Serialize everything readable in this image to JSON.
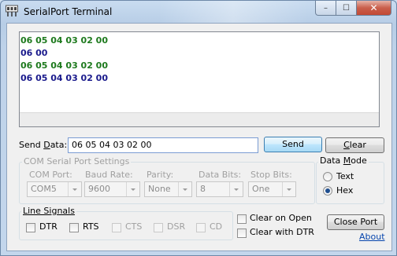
{
  "window": {
    "title": "SerialPort Terminal"
  },
  "titlebar_controls": {
    "minimize": "–",
    "maximize": "☐",
    "close": "✕"
  },
  "terminal": {
    "lines": [
      {
        "text": "06 05 04 03 02 00",
        "color": "#1e7a1e"
      },
      {
        "text": "06 00",
        "color": "#1a1a8c"
      },
      {
        "text": "06 05 04 03 02 00",
        "color": "#1e7a1e"
      },
      {
        "text": "06 05 04 03 02 00",
        "color": "#1a1a8c"
      }
    ]
  },
  "send": {
    "label_prefix": "Send ",
    "label_underlined": "D",
    "label_suffix": "ata:",
    "value": "06 05 04 03 02 00",
    "send_button": "Send",
    "clear_button_underlined": "C",
    "clear_button_suffix": "lear"
  },
  "com_settings": {
    "group_title": "COM Serial Port Settings",
    "port_label": "COM Port:",
    "port_value": "COM5",
    "baud_label": "Baud Rate:",
    "baud_value": "9600",
    "parity_label": "Parity:",
    "parity_value": "None",
    "databits_label": "Data Bits:",
    "databits_value": "8",
    "stopbits_label": "Stop Bits:",
    "stopbits_value": "One"
  },
  "data_mode": {
    "group_title_prefix": "Data ",
    "group_title_underlined": "M",
    "group_title_suffix": "ode",
    "text_label": "Text",
    "hex_label": "Hex",
    "selected": "Hex"
  },
  "line_signals": {
    "group_title": "Line Signals",
    "dtr": "DTR",
    "rts": "RTS",
    "cts": "CTS",
    "dsr": "DSR",
    "cd": "CD"
  },
  "options": {
    "clear_on_open": "Clear on Open",
    "clear_with_dtr": "Clear with DTR"
  },
  "actions": {
    "close_port": "Close Port",
    "about": "About"
  },
  "colors": {
    "received": "#1e7a1e",
    "sent": "#1a1a8c"
  }
}
